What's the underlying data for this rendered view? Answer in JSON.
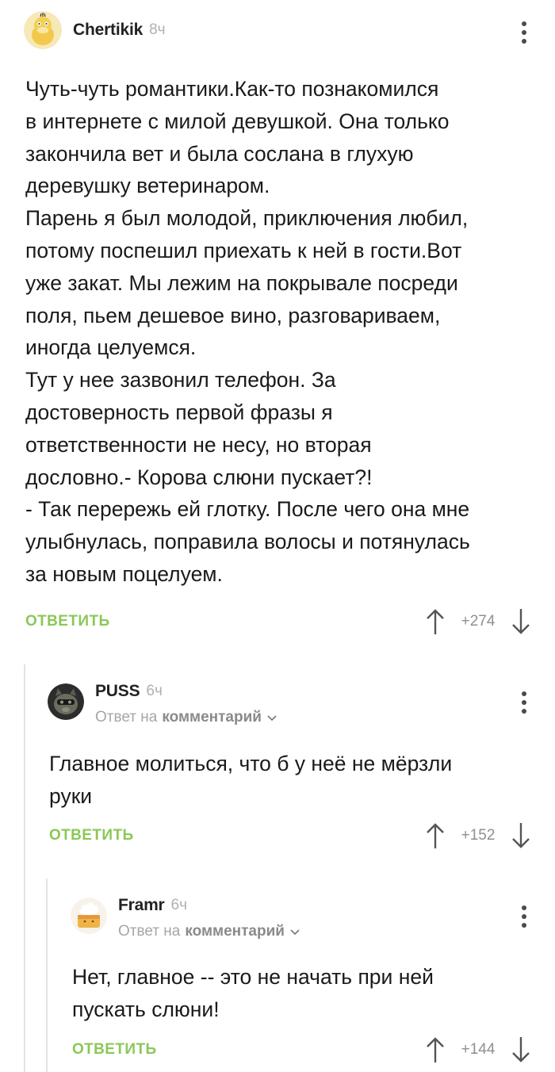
{
  "comments": [
    {
      "author": "Chertikik",
      "time": "8ч",
      "text": "Чуть-чуть романтики.Как-то познакомился\nв интернете с милой девушкой. Она только\nзакончила вет и была сослана в глухую\nдеревушку ветеринаром.\nПарень я был молодой, приключения любил,\nпотому поспешил приехать к ней в гости.Вот\nуже закат. Мы лежим на покрывале посреди\nполя, пьем дешевое вино, разговариваем,\nиногда целуемся.\nТут у нее зазвонил телефон. За\nдостоверность первой фразы я\nответственности не несу, но вторая\nдословно.- Корова слюни пускает?!\n- Так перережь ей глотку. После чего она мне\nулыбнулась, поправила волосы и потянулась\nза новым поцелуем.",
      "reply_label": "ОТВЕТИТЬ",
      "score": "+274"
    },
    {
      "author": "PUSS",
      "time": "6ч",
      "reply_to_prefix": "Ответ на",
      "reply_to_target": "комментарий",
      "text": "Главное молиться, что б у неё не мёрзли\nруки",
      "reply_label": "ОТВЕТИТЬ",
      "score": "+152"
    },
    {
      "author": "Framr",
      "time": "6ч",
      "reply_to_prefix": "Ответ на",
      "reply_to_target": "комментарий",
      "text": "Нет, главное -- это не начать при ней\nпускать слюни!",
      "reply_label": "ОТВЕТИТЬ",
      "score": "+144"
    }
  ],
  "colors": {
    "accent_green": "#8ac858",
    "thread_line": "#e3e3e3"
  },
  "icons": [
    "psyduck-avatar",
    "cat-avatar",
    "cake-avatar",
    "kebab-menu-icon",
    "chevron-down-icon",
    "arrow-up-icon",
    "arrow-down-icon"
  ]
}
